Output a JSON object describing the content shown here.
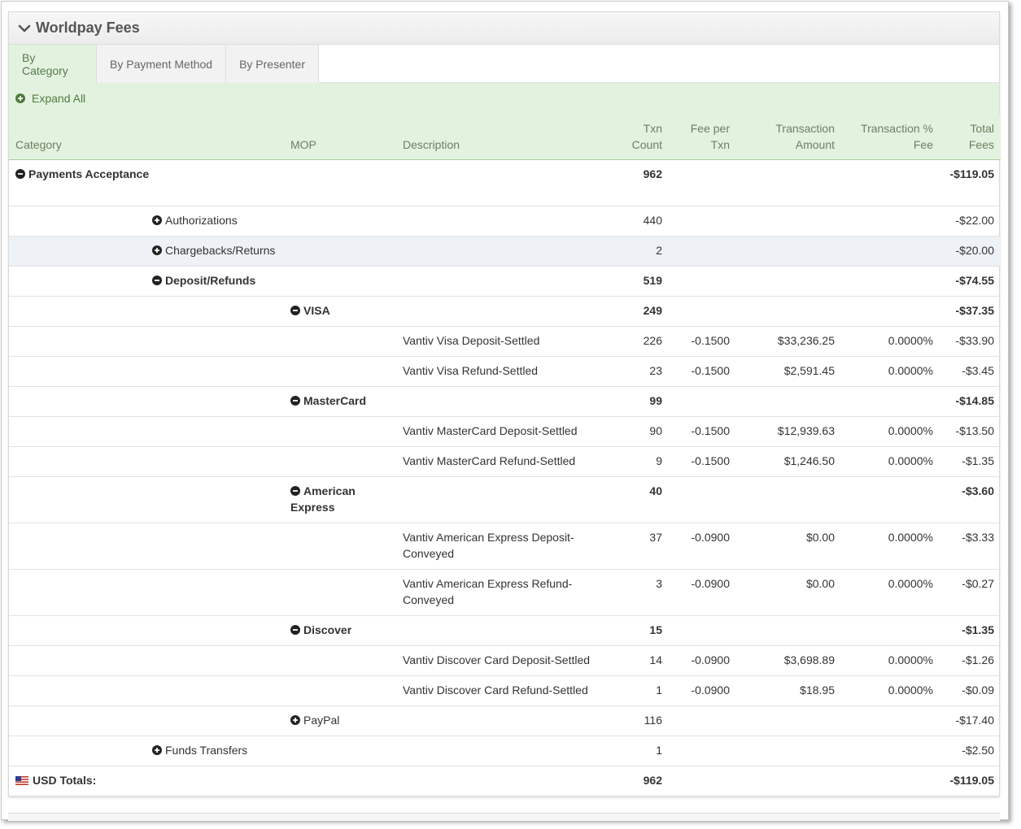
{
  "panel": {
    "title": "Worldpay Fees",
    "collapse_icon": "chevron-down-icon"
  },
  "tabs": [
    {
      "label": "By Category",
      "active": true
    },
    {
      "label": "By Payment Method",
      "active": false
    },
    {
      "label": "By Presenter",
      "active": false
    }
  ],
  "expand_all": {
    "label": "Expand All",
    "icon": "plus-circle-icon"
  },
  "columns": {
    "category": "Category",
    "mop": "MOP",
    "description": "Description",
    "txn_count_1": "Txn",
    "txn_count_2": "Count",
    "fee_per_txn_1": "Fee per",
    "fee_per_txn_2": "Txn",
    "txn_amount_1": "Transaction",
    "txn_amount_2": "Amount",
    "txn_pct_1": "Transaction %",
    "txn_pct_2": "Fee",
    "total_fees_1": "Total",
    "total_fees_2": "Fees"
  },
  "rows": {
    "payments_acceptance": {
      "category": "Payments Acceptance",
      "count": "962",
      "total": "-$119.05",
      "icon": "minus-circle-icon"
    },
    "authorizations": {
      "category": "Authorizations",
      "count": "440",
      "total": "-$22.00",
      "icon": "plus-circle-icon"
    },
    "chargebacks": {
      "category": "Chargebacks/Returns",
      "count": "2",
      "total": "-$20.00",
      "icon": "plus-circle-icon"
    },
    "deposit_refunds": {
      "category": "Deposit/Refunds",
      "count": "519",
      "total": "-$74.55",
      "icon": "minus-circle-icon"
    },
    "visa": {
      "mop": "VISA",
      "count": "249",
      "total": "-$37.35",
      "icon": "minus-circle-icon"
    },
    "visa_deposit": {
      "description": "Vantiv Visa Deposit-Settled",
      "count": "226",
      "fee": "-0.1500",
      "amount": "$33,236.25",
      "pct": "0.0000%",
      "total": "-$33.90"
    },
    "visa_refund": {
      "description": "Vantiv Visa Refund-Settled",
      "count": "23",
      "fee": "-0.1500",
      "amount": "$2,591.45",
      "pct": "0.0000%",
      "total": "-$3.45"
    },
    "mastercard": {
      "mop": "MasterCard",
      "count": "99",
      "total": "-$14.85",
      "icon": "minus-circle-icon"
    },
    "mc_deposit": {
      "description": "Vantiv MasterCard Deposit-Settled",
      "count": "90",
      "fee": "-0.1500",
      "amount": "$12,939.63",
      "pct": "0.0000%",
      "total": "-$13.50"
    },
    "mc_refund": {
      "description": "Vantiv MasterCard Refund-Settled",
      "count": "9",
      "fee": "-0.1500",
      "amount": "$1,246.50",
      "pct": "0.0000%",
      "total": "-$1.35"
    },
    "amex": {
      "mop": "American Express",
      "count": "40",
      "total": "-$3.60",
      "icon": "minus-circle-icon"
    },
    "amex_deposit": {
      "description": "Vantiv American Express Deposit-Conveyed",
      "count": "37",
      "fee": "-0.0900",
      "amount": "$0.00",
      "pct": "0.0000%",
      "total": "-$3.33"
    },
    "amex_refund": {
      "description": "Vantiv American Express Refund-Conveyed",
      "count": "3",
      "fee": "-0.0900",
      "amount": "$0.00",
      "pct": "0.0000%",
      "total": "-$0.27"
    },
    "discover": {
      "mop": "Discover",
      "count": "15",
      "total": "-$1.35",
      "icon": "minus-circle-icon"
    },
    "disc_deposit": {
      "description": "Vantiv Discover Card Deposit-Settled",
      "count": "14",
      "fee": "-0.0900",
      "amount": "$3,698.89",
      "pct": "0.0000%",
      "total": "-$1.26"
    },
    "disc_refund": {
      "description": "Vantiv Discover Card Refund-Settled",
      "count": "1",
      "fee": "-0.0900",
      "amount": "$18.95",
      "pct": "0.0000%",
      "total": "-$0.09"
    },
    "paypal": {
      "mop": "PayPal",
      "count": "116",
      "total": "-$17.40",
      "icon": "plus-circle-icon"
    },
    "funds_transfers": {
      "category": "Funds Transfers",
      "count": "1",
      "total": "-$2.50",
      "icon": "plus-circle-icon"
    },
    "usd_totals": {
      "category": "USD Totals:",
      "count": "962",
      "total": "-$119.05",
      "icon": "us-flag-icon"
    }
  }
}
